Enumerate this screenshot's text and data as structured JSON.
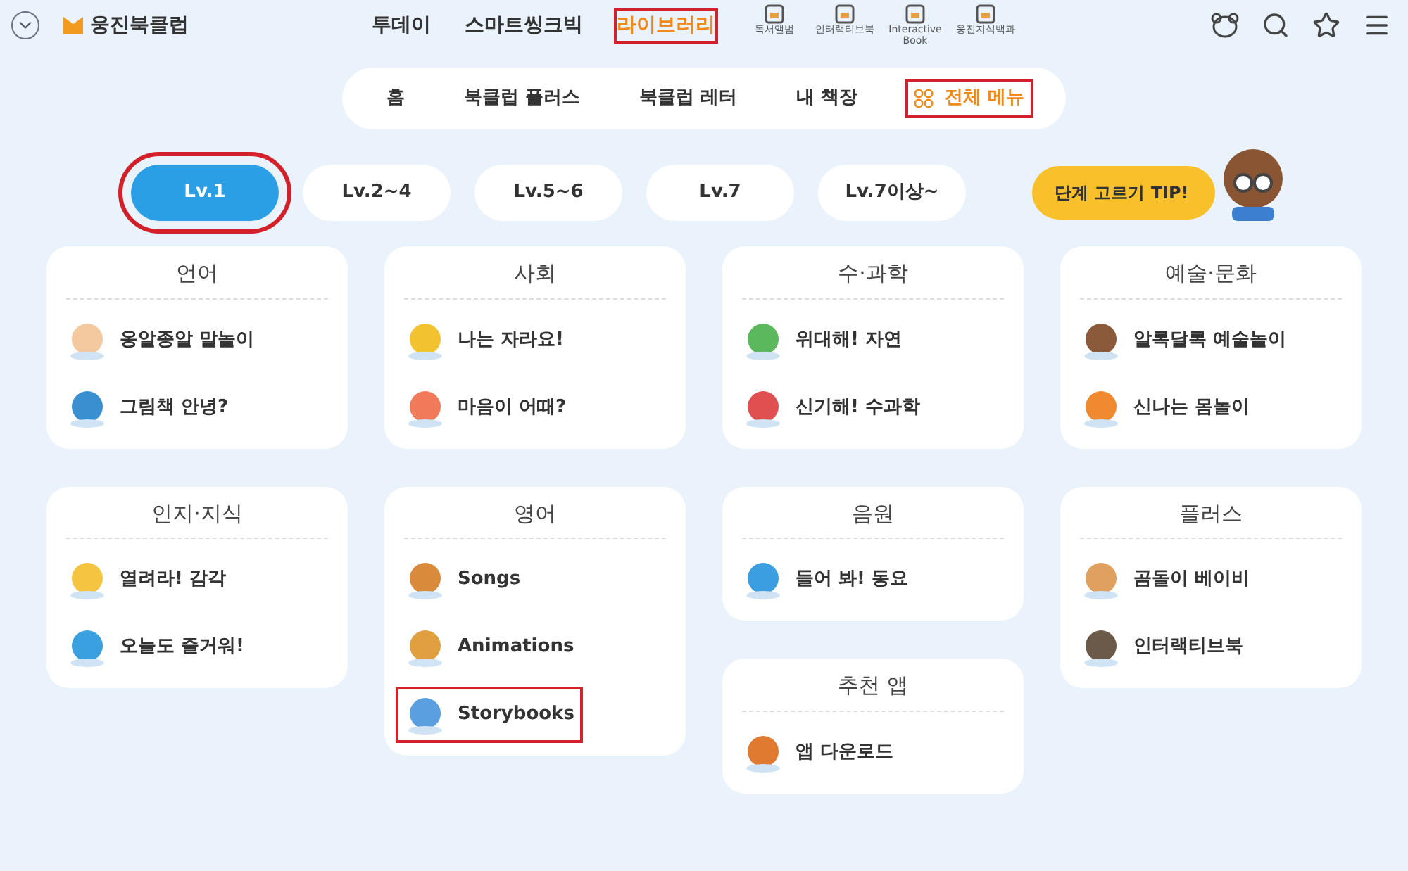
{
  "header": {
    "logo": "웅진북클럽",
    "nav": [
      {
        "label": "투데이",
        "selected": false,
        "highlighted": false
      },
      {
        "label": "스마트씽크빅",
        "selected": false,
        "highlighted": false
      },
      {
        "label": "라이브러리",
        "selected": true,
        "highlighted": true
      }
    ],
    "shortcuts": [
      {
        "label": "독서앨범"
      },
      {
        "label": "인터랙티브북"
      },
      {
        "label": "Interactive Book"
      },
      {
        "label": "웅진지식백과"
      }
    ]
  },
  "submenu": [
    {
      "label": "홈",
      "kind": "link",
      "highlighted": false
    },
    {
      "label": "북클럽 플러스",
      "kind": "link",
      "highlighted": false
    },
    {
      "label": "북클럽 레터",
      "kind": "link",
      "highlighted": false
    },
    {
      "label": "내 책장",
      "kind": "link",
      "highlighted": false
    },
    {
      "label": "전체 메뉴",
      "kind": "menu",
      "highlighted": true
    }
  ],
  "levels": [
    {
      "label": "Lv.1",
      "selected": true,
      "highlighted": true
    },
    {
      "label": "Lv.2~4",
      "selected": false,
      "highlighted": false
    },
    {
      "label": "Lv.5~6",
      "selected": false,
      "highlighted": false
    },
    {
      "label": "Lv.7",
      "selected": false,
      "highlighted": false
    },
    {
      "label": "Lv.7이상~",
      "selected": false,
      "highlighted": false
    }
  ],
  "tip_button": "단계 고르기 TIP!",
  "columns": [
    [
      {
        "title": "언어",
        "items": [
          {
            "label": "옹알종알 말놀이",
            "color": "#f4c9a0",
            "highlighted": false
          },
          {
            "label": "그림책 안녕?",
            "color": "#3a8fd0",
            "highlighted": false
          }
        ]
      },
      {
        "title": "인지·지식",
        "items": [
          {
            "label": "열려라! 감각",
            "color": "#f5c542",
            "highlighted": false
          },
          {
            "label": "오늘도 즐거워!",
            "color": "#3aa0e0",
            "highlighted": false
          }
        ]
      }
    ],
    [
      {
        "title": "사회",
        "items": [
          {
            "label": "나는 자라요!",
            "color": "#f2c230",
            "highlighted": false
          },
          {
            "label": "마음이 어때?",
            "color": "#f07a5a",
            "highlighted": false
          }
        ]
      },
      {
        "title": "영어",
        "items": [
          {
            "label": "Songs",
            "color": "#d98a3a",
            "highlighted": false
          },
          {
            "label": "Animations",
            "color": "#e0a040",
            "highlighted": false
          },
          {
            "label": "Storybooks",
            "color": "#5aa0e0",
            "highlighted": true
          }
        ]
      }
    ],
    [
      {
        "title": "수·과학",
        "items": [
          {
            "label": "위대해! 자연",
            "color": "#5cb85c",
            "highlighted": false
          },
          {
            "label": "신기해! 수과학",
            "color": "#e05050",
            "highlighted": false
          }
        ]
      },
      {
        "title": "음원",
        "items": [
          {
            "label": "들어 봐! 동요",
            "color": "#3a9ee0",
            "highlighted": false
          }
        ]
      },
      {
        "title": "추천 앱",
        "items": [
          {
            "label": "앱 다운로드",
            "color": "#e07a30",
            "highlighted": false
          }
        ]
      }
    ],
    [
      {
        "title": "예술·문화",
        "items": [
          {
            "label": "알록달록 예술놀이",
            "color": "#8a5a3a",
            "highlighted": false
          },
          {
            "label": "신나는 몸놀이",
            "color": "#f08a30",
            "highlighted": false
          }
        ]
      },
      {
        "title": "플러스",
        "items": [
          {
            "label": "곰돌이 베이비",
            "color": "#e0a060",
            "highlighted": false
          },
          {
            "label": "인터랙티브북",
            "color": "#6b5a4a",
            "highlighted": false
          }
        ]
      }
    ]
  ]
}
